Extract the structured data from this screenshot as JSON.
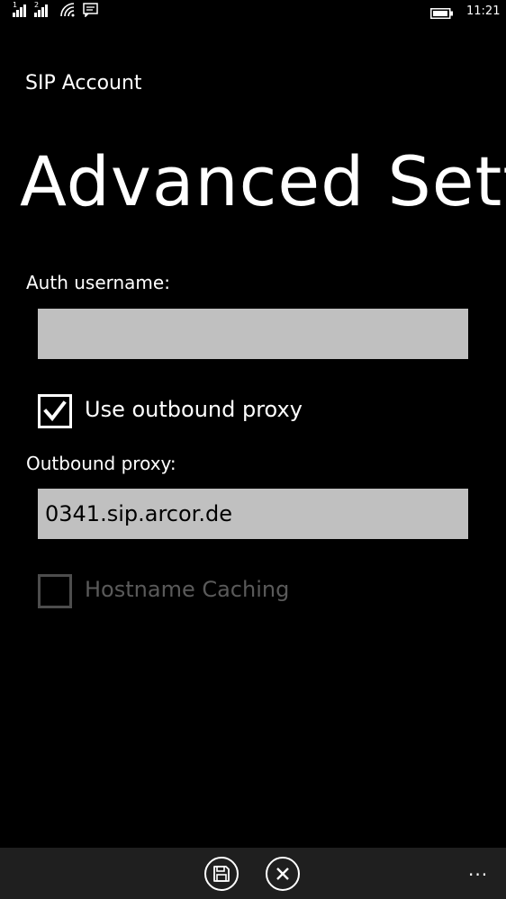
{
  "status_bar": {
    "sim1_label": "1",
    "sim2_label": "2",
    "time": "11:21",
    "icons": [
      "signal-icon",
      "signal-icon",
      "wifi-icon",
      "message-icon",
      "battery-icon"
    ]
  },
  "header": {
    "app_title": "SIP Account",
    "page_title": "Advanced Settings"
  },
  "form": {
    "auth_username": {
      "label": "Auth username:",
      "value": ""
    },
    "use_outbound_proxy": {
      "label": "Use outbound proxy",
      "checked": true
    },
    "outbound_proxy": {
      "label": "Outbound proxy:",
      "value": "0341.sip.arcor.de"
    },
    "hostname_caching": {
      "label": "Hostname Caching",
      "checked": false,
      "disabled": true
    }
  },
  "app_bar": {
    "buttons": [
      "save-icon",
      "cancel-icon"
    ],
    "more_label": "..."
  },
  "colors": {
    "background": "#000000",
    "input_background": "#c0c0c0",
    "disabled_text": "#5a5a5a",
    "app_bar": "#1f1f1f"
  }
}
